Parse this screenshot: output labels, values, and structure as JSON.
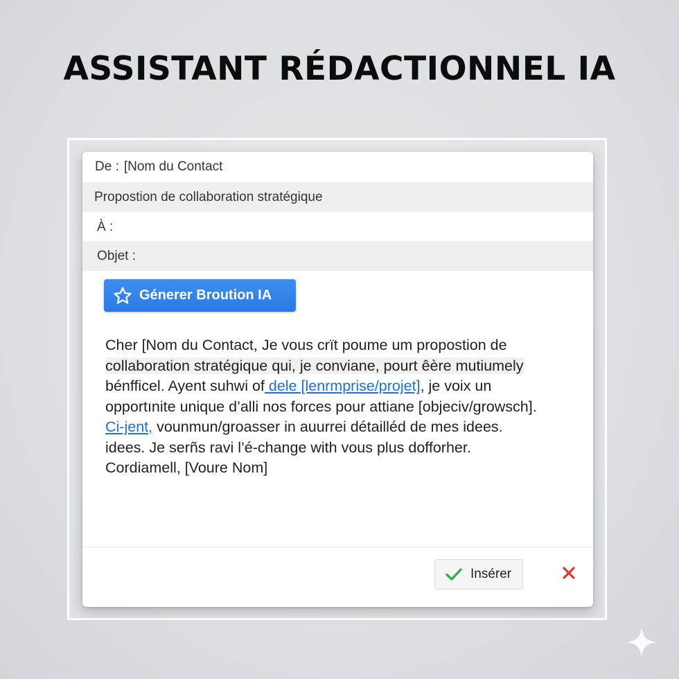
{
  "page": {
    "title": "ASSISTANT RÉDACTIONNEL IA"
  },
  "email": {
    "from_label": "De :",
    "from_value": "[Nom du Contact",
    "subject_value": "Propostion de collaboration stratégique",
    "to_label": "À :",
    "object_label": "Objet :"
  },
  "generate": {
    "label": "Génerer Broution IA",
    "icon": "star-icon"
  },
  "message": {
    "lines": [
      "Cher [Nom du Contact, Je vous crït poume um propostion de",
      "collaboration stratégique qui, je conviane, pourt êère mutiumely",
      "bénfficel. Ayent suhwi of",
      " dele [lenrmprise/projet]",
      ", je voix un",
      "opportınite unique d’alli nos forces pour attiane [objeciv/growsch].",
      "Ci-jent,",
      " vounmun/groasser in auurrei détailléd de mes idees.",
      "idees. Je serñs ravi l’é-change with vous plus dofforher.",
      "Cordiamell, [Voure Nom]"
    ]
  },
  "actions": {
    "insert_label": "Insérer",
    "insert_icon": "check-icon",
    "close_icon": "close-icon"
  },
  "colors": {
    "accent": "#2a7ae3",
    "link": "#1f6fd6",
    "check": "#2bb14a",
    "close": "#d93636"
  }
}
